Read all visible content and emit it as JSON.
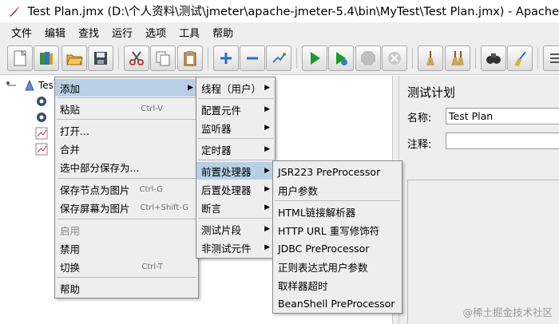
{
  "window": {
    "title": "Test Plan.jmx (D:\\个人资料\\测试\\jmeter\\apache-jmeter-5.4\\bin\\MyTest\\Test Plan.jmx) - Apache"
  },
  "menubar": [
    "文件",
    "编辑",
    "查找",
    "运行",
    "选项",
    "工具",
    "帮助"
  ],
  "toolbar": [
    {
      "icon": "new-icon"
    },
    {
      "icon": "templates-icon"
    },
    {
      "icon": "open-icon"
    },
    {
      "icon": "save-icon"
    },
    {
      "icon": "cut-icon"
    },
    {
      "icon": "copy-icon"
    },
    {
      "icon": "paste-icon"
    },
    {
      "icon": "expand-icon"
    },
    {
      "icon": "collapse-icon"
    },
    {
      "icon": "toggle-icon"
    },
    {
      "icon": "start-icon"
    },
    {
      "icon": "start-no-pause-icon"
    },
    {
      "icon": "stop-icon"
    },
    {
      "icon": "shutdown-icon"
    },
    {
      "icon": "clear-icon"
    },
    {
      "icon": "clear-all-icon"
    },
    {
      "icon": "search-icon"
    },
    {
      "icon": "reset-search-icon"
    },
    {
      "icon": "function-helper-icon"
    }
  ],
  "tree": {
    "root": "Tes"
  },
  "context_menu": {
    "items": [
      {
        "label": "添加",
        "arrow": true,
        "highlighted": true
      },
      {
        "label": "粘贴",
        "accel": "Ctrl-V"
      },
      {
        "label": "打开..."
      },
      {
        "label": "合并"
      },
      {
        "label": "选中部分保存为..."
      },
      {
        "label": "保存节点为图片",
        "accel": "Ctrl-G"
      },
      {
        "label": "保存屏幕为图片",
        "accel": "Ctrl+Shift-G"
      },
      {
        "label": "启用",
        "disabled": true
      },
      {
        "label": "禁用"
      },
      {
        "label": "切换",
        "accel": "Ctrl-T"
      },
      {
        "label": "帮助"
      }
    ]
  },
  "add_submenu": {
    "items": [
      {
        "label": "线程（用户）"
      },
      {
        "label": "配置元件"
      },
      {
        "label": "监听器"
      },
      {
        "label": "定时器"
      },
      {
        "label": "前置处理器",
        "highlighted": true
      },
      {
        "label": "后置处理器"
      },
      {
        "label": "断言"
      },
      {
        "label": "测试片段"
      },
      {
        "label": "非测试元件"
      }
    ]
  },
  "preprocessor_submenu": {
    "items": [
      {
        "label": "JSR223 PreProcessor"
      },
      {
        "label": "用户参数"
      },
      {
        "label": "HTML链接解析器"
      },
      {
        "label": "HTTP URL 重写修饰符"
      },
      {
        "label": "JDBC PreProcessor"
      },
      {
        "label": "正则表达式用户参数"
      },
      {
        "label": "取样器超时"
      },
      {
        "label": "BeanShell PreProcessor"
      }
    ]
  },
  "panel": {
    "title": "测试计划",
    "name_label": "名称:",
    "name_value": "Test Plan",
    "comment_label": "注释:",
    "comment_value": ""
  },
  "watermark": "@稀土掘金技术社区"
}
